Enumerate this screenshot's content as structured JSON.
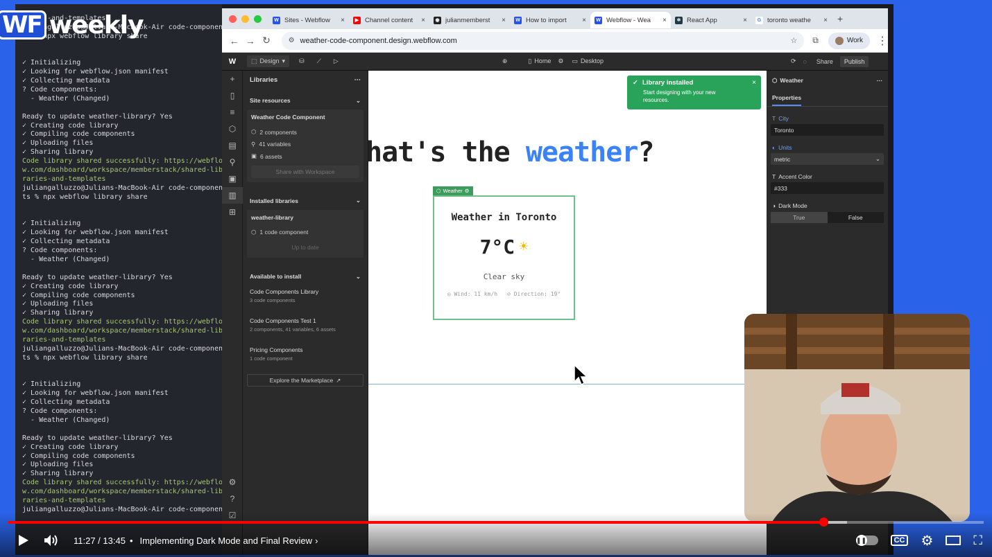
{
  "brand": {
    "box": "WF",
    "word": "weekly"
  },
  "terminal": {
    "lines": [
      [
        "ok",
        ""
      ],
      [
        "ok",
        "raries-and-templates"
      ],
      [
        "ok",
        "juliangalluzzo@Julians-MacBook-Air code-componen"
      ],
      [
        "ok",
        "ts % npx webflow library share"
      ],
      [
        "ok",
        ""
      ],
      [
        "ok",
        ""
      ],
      [
        "ok",
        "✓ Initializing"
      ],
      [
        "ok",
        "✓ Looking for webflow.json manifest"
      ],
      [
        "ok",
        "✓ Collecting metadata"
      ],
      [
        "y",
        "? Code components:"
      ],
      [
        "y",
        "  - Weather (Changed)"
      ],
      [
        "ok",
        ""
      ],
      [
        "y",
        "Ready to update weather-library? Yes"
      ],
      [
        "ok",
        "✓ Creating code library"
      ],
      [
        "ok",
        "✓ Compiling code components"
      ],
      [
        "ok",
        "✓ Uploading files"
      ],
      [
        "ok",
        "✓ Sharing library"
      ],
      [
        "g",
        "Code library shared successfully: https://webflo"
      ],
      [
        "g",
        "w.com/dashboard/workspace/memberstack/shared-lib"
      ],
      [
        "g",
        "raries-and-templates"
      ],
      [
        "ok",
        "juliangalluzzo@Julians-MacBook-Air code-componen"
      ],
      [
        "ok",
        "ts % npx webflow library share"
      ],
      [
        "ok",
        ""
      ],
      [
        "ok",
        ""
      ],
      [
        "ok",
        "✓ Initializing"
      ],
      [
        "ok",
        "✓ Looking for webflow.json manifest"
      ],
      [
        "ok",
        "✓ Collecting metadata"
      ],
      [
        "y",
        "? Code components:"
      ],
      [
        "y",
        "  - Weather (Changed)"
      ],
      [
        "ok",
        ""
      ],
      [
        "y",
        "Ready to update weather-library? Yes"
      ],
      [
        "ok",
        "✓ Creating code library"
      ],
      [
        "ok",
        "✓ Compiling code components"
      ],
      [
        "ok",
        "✓ Uploading files"
      ],
      [
        "ok",
        "✓ Sharing library"
      ],
      [
        "g",
        "Code library shared successfully: https://webflo"
      ],
      [
        "g",
        "w.com/dashboard/workspace/memberstack/shared-lib"
      ],
      [
        "g",
        "raries-and-templates"
      ],
      [
        "ok",
        "juliangalluzzo@Julians-MacBook-Air code-componen"
      ],
      [
        "ok",
        "ts % npx webflow library share"
      ],
      [
        "ok",
        ""
      ],
      [
        "ok",
        ""
      ],
      [
        "ok",
        "✓ Initializing"
      ],
      [
        "ok",
        "✓ Looking for webflow.json manifest"
      ],
      [
        "ok",
        "✓ Collecting metadata"
      ],
      [
        "y",
        "? Code components:"
      ],
      [
        "y",
        "  - Weather (Changed)"
      ],
      [
        "ok",
        ""
      ],
      [
        "y",
        "Ready to update weather-library? Yes"
      ],
      [
        "ok",
        "✓ Creating code library"
      ],
      [
        "ok",
        "✓ Compiling code components"
      ],
      [
        "ok",
        "✓ Uploading files"
      ],
      [
        "ok",
        "✓ Sharing library"
      ],
      [
        "g",
        "Code library shared successfully: https://webflo"
      ],
      [
        "g",
        "w.com/dashboard/workspace/memberstack/shared-lib"
      ],
      [
        "g",
        "raries-and-templates"
      ],
      [
        "ok",
        "juliangalluzzo@Julians-MacBook-Air code-componen"
      ]
    ]
  },
  "browser": {
    "tabs": [
      {
        "title": "Sites - Webflow",
        "fav": "#2353f6",
        "glyph": "W"
      },
      {
        "title": "Channel content",
        "fav": "#ff0000",
        "glyph": "▶"
      },
      {
        "title": "julianmemberst",
        "fav": "#222",
        "glyph": "◉"
      },
      {
        "title": "How to import",
        "fav": "#2353f6",
        "glyph": "W"
      },
      {
        "title": "Webflow - Wea",
        "fav": "#2353f6",
        "glyph": "W",
        "active": true
      },
      {
        "title": "React App",
        "fav": "#1e3b4a",
        "glyph": "⚛"
      },
      {
        "title": "toronto weathe",
        "fav": "#fff",
        "glyph": "G"
      }
    ],
    "url": "weather-code-component.design.webflow.com",
    "profile": "Work"
  },
  "webflow": {
    "mode": "Design",
    "page": "Home",
    "breakpoint": "Desktop",
    "share": "Share",
    "publish": "Publish",
    "libraries": {
      "title": "Libraries",
      "site_resources": "Site resources",
      "site_card": {
        "name": "Weather Code Component",
        "rows": [
          "2 components",
          "41 variables",
          "6 assets"
        ],
        "button": "Share with Workspace"
      },
      "installed": "Installed libraries",
      "inst_card": {
        "name": "weather-library",
        "rows": [
          "1 code component"
        ],
        "button": "Up to date"
      },
      "available": "Available to install",
      "items": [
        {
          "name": "Code Components Library",
          "sub": "3 code components"
        },
        {
          "name": "Code Components Test 1",
          "sub": "2 components, 41 variables, 6 assets"
        },
        {
          "name": "Pricing Components",
          "sub": "1 code component"
        }
      ],
      "explore": "Explore the Marketplace"
    },
    "canvas": {
      "heading_pre": "hat's the ",
      "heading_accent": "weather",
      "heading_post": "?",
      "card_label": "Weather",
      "city": "Weather in Toronto",
      "temp": "7°C",
      "desc": "Clear sky",
      "wind": "Wind: 11 km/h",
      "direction": "Direction: 19°"
    },
    "toast": {
      "title": "Library installed",
      "body": "Start designing with your new resources."
    },
    "props": {
      "title": "Weather",
      "tab": "Properties",
      "city_label": "City",
      "city_value": "Toronto",
      "units_label": "Units",
      "units_value": "metric",
      "accent_label": "Accent Color",
      "accent_value": "#333",
      "dark_label": "Dark Mode",
      "true": "True",
      "false": "False"
    }
  },
  "player": {
    "time": "11:27 / 13:45",
    "chapter": "Implementing Dark Mode and Final Review",
    "progress": 0.836,
    "buffered": 0.86
  }
}
